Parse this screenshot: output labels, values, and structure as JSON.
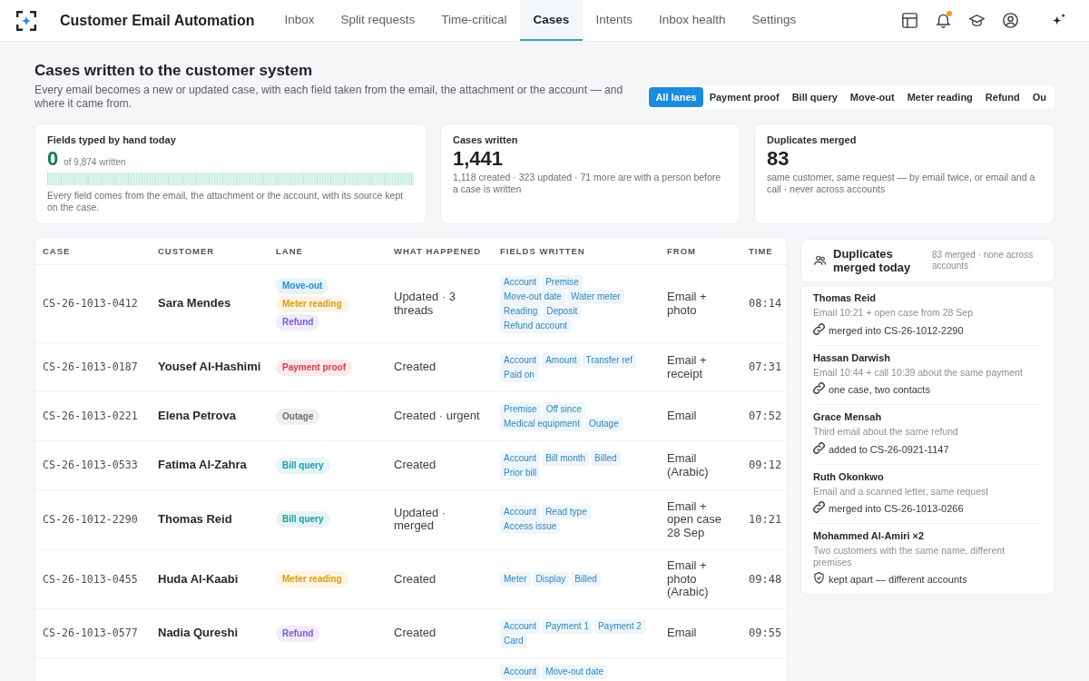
{
  "app": {
    "title": "Customer Email Automation"
  },
  "nav": [
    {
      "label": "Inbox",
      "selected": false
    },
    {
      "label": "Split requests",
      "selected": false
    },
    {
      "label": "Time-critical",
      "selected": false
    },
    {
      "label": "Cases",
      "selected": true
    },
    {
      "label": "Intents",
      "selected": false
    },
    {
      "label": "Inbox health",
      "selected": false
    },
    {
      "label": "Settings",
      "selected": false
    }
  ],
  "notifications": {
    "unread": true
  },
  "page": {
    "title": "Cases written to the customer system",
    "subtitle": "Every email becomes a new or updated case, with each field taken from the email, the attachment or the account — and where it came from."
  },
  "lane_filters": [
    {
      "label": "All lanes",
      "selected": true
    },
    {
      "label": "Payment proof",
      "selected": false
    },
    {
      "label": "Bill query",
      "selected": false
    },
    {
      "label": "Move-out",
      "selected": false
    },
    {
      "label": "Meter reading",
      "selected": false
    },
    {
      "label": "Refund",
      "selected": false
    },
    {
      "label": "Ou",
      "selected": false
    }
  ],
  "stats": [
    {
      "kind": "strip",
      "label": "Fields typed by hand today",
      "value": "0",
      "value_note": "of 9,874 written",
      "note": "Every field comes from the email, the attachment or the account, with its source kept on the case."
    },
    {
      "kind": "plain",
      "label": "Cases written",
      "value": "1,441",
      "note": "1,118 created · 323 updated · 71 more are with a person before a case is written"
    },
    {
      "kind": "plain",
      "label": "Duplicates merged",
      "value": "83",
      "note": "same customer, same request — by email twice, or email and a call · never across accounts"
    }
  ],
  "table": {
    "columns": [
      "CASE",
      "CUSTOMER",
      "LANE",
      "WHAT HAPPENED",
      "FIELDS WRITTEN",
      "FROM",
      "TIME"
    ],
    "rows": [
      {
        "case": "CS-26-1013-0412",
        "customer": "Sara Mendes",
        "lanes": [
          {
            "label": "Move-out",
            "color": "#1e90d8"
          },
          {
            "label": "Meter reading",
            "color": "#e39b0b"
          },
          {
            "label": "Refund",
            "color": "#7a5ad8"
          }
        ],
        "what_happened": "Updated · 3 threads",
        "fields": [
          "Account",
          "Premise",
          "Move-out date",
          "Water meter",
          "Reading",
          "Deposit",
          "Refund account"
        ],
        "from": "Email + photo",
        "time": "08:14"
      },
      {
        "case": "CS-26-1013-0187",
        "customer": "Yousef Al-Hashimi",
        "lanes": [
          {
            "label": "Payment proof",
            "color": "#e0384c"
          }
        ],
        "what_happened": "Created",
        "fields": [
          "Account",
          "Amount",
          "Transfer ref",
          "Paid on"
        ],
        "from": "Email + receipt",
        "time": "07:31"
      },
      {
        "case": "CS-26-1013-0221",
        "customer": "Elena Petrova",
        "lanes": [
          {
            "label": "Outage",
            "color": "#6b6f76"
          }
        ],
        "what_happened": "Created · urgent",
        "fields": [
          "Premise",
          "Off since",
          "Medical equipment",
          "Outage"
        ],
        "from": "Email",
        "time": "07:52"
      },
      {
        "case": "CS-26-1013-0533",
        "customer": "Fatima Al-Zahra",
        "lanes": [
          {
            "label": "Bill query",
            "color": "#1a9aa8"
          }
        ],
        "what_happened": "Created",
        "fields": [
          "Account",
          "Bill month",
          "Billed",
          "Prior bill"
        ],
        "from": "Email (Arabic)",
        "time": "09:12"
      },
      {
        "case": "CS-26-1012-2290",
        "customer": "Thomas Reid",
        "lanes": [
          {
            "label": "Bill query",
            "color": "#1a9aa8"
          }
        ],
        "what_happened": "Updated · merged",
        "fields": [
          "Account",
          "Read type",
          "Access issue"
        ],
        "from": "Email + open case 28 Sep",
        "time": "10:21"
      },
      {
        "case": "CS-26-1013-0455",
        "customer": "Huda Al-Kaabi",
        "lanes": [
          {
            "label": "Meter reading",
            "color": "#e39b0b"
          }
        ],
        "what_happened": "Created",
        "fields": [
          "Meter",
          "Display",
          "Billed"
        ],
        "from": "Email + photo (Arabic)",
        "time": "09:48"
      },
      {
        "case": "CS-26-1013-0577",
        "customer": "Nadia Qureshi",
        "lanes": [
          {
            "label": "Refund",
            "color": "#7a5ad8"
          }
        ],
        "what_happened": "Created",
        "fields": [
          "Account",
          "Payment 1",
          "Payment 2",
          "Card"
        ],
        "from": "Email",
        "time": "09:55"
      },
      {
        "fields": [
          "Account",
          "Move-out date"
        ]
      }
    ]
  },
  "duplicates": {
    "title": "Duplicates merged today",
    "summary": "83 merged · none across accounts",
    "items": [
      {
        "name": "Thomas Reid",
        "detail": "Email 10:21 + open case from 28 Sep",
        "kind": "merged",
        "outcome": "merged into CS-26-1012-2290"
      },
      {
        "name": "Hassan Darwish",
        "detail": "Email 10:44 + call 10:39 about the same payment",
        "kind": "merged",
        "outcome": "one case, two contacts"
      },
      {
        "name": "Grace Mensah",
        "detail": "Third email about the same refund",
        "kind": "merged",
        "outcome": "added to CS-26-0921-1147"
      },
      {
        "name": "Ruth Okonkwo",
        "detail": "Email and a scanned letter, same request",
        "kind": "merged",
        "outcome": "merged into CS-26-1013-0266"
      },
      {
        "name": "Mohammed Al-Amiri ×2",
        "detail": "Two customers with the same name, different premises",
        "kind": "kept_apart",
        "outcome": "kept apart — different accounts"
      }
    ]
  }
}
